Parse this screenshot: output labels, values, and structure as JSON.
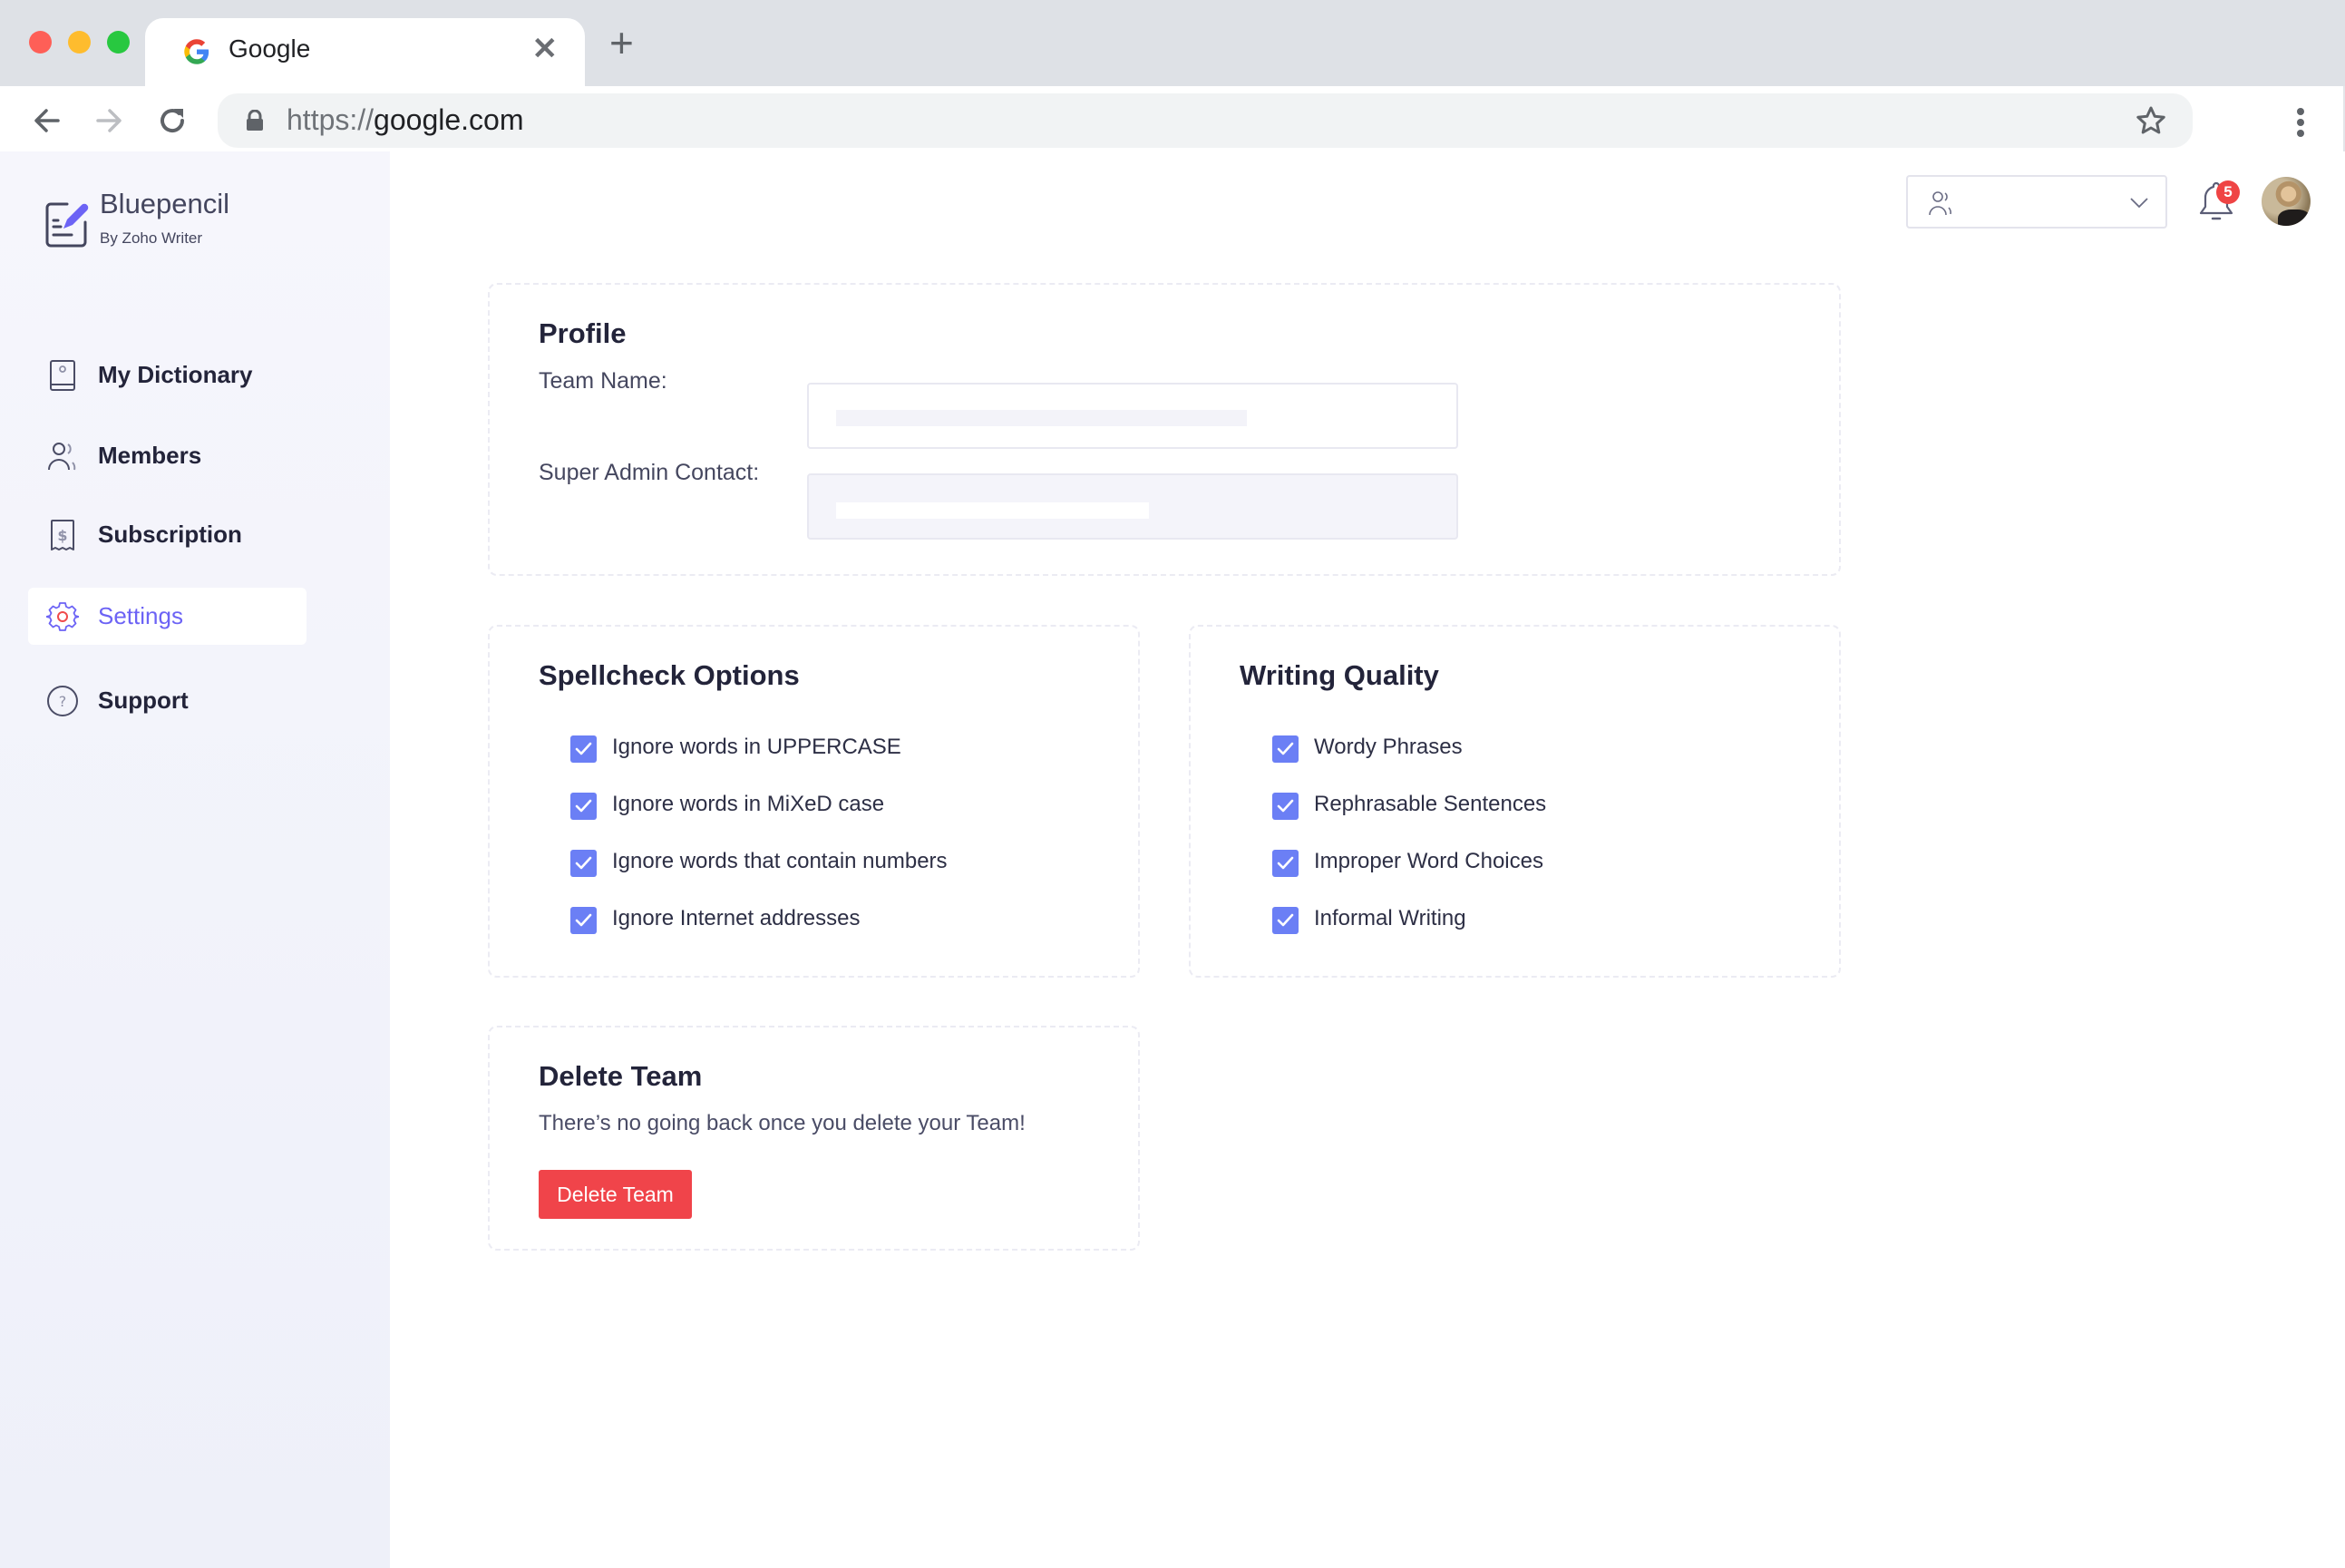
{
  "browser": {
    "tab_title": "Google",
    "tab_favicon": "google-g-icon",
    "url_scheme": "https://",
    "url_host": "google.com",
    "icons": [
      "back-arrow-icon",
      "forward-arrow-icon",
      "reload-icon",
      "lock-icon",
      "star-icon",
      "kebab-menu-icon",
      "close-icon",
      "plus-icon"
    ]
  },
  "app": {
    "brand_name": "Bluepencil",
    "brand_sub": "By Zoho Writer",
    "accent_color": "#6c63f5",
    "checkbox_color": "#6b7ff5",
    "danger_color": "#f0444a"
  },
  "sidebar": {
    "items": [
      {
        "label": "My Dictionary",
        "icon": "dictionary-book-icon",
        "active": false
      },
      {
        "label": "Members",
        "icon": "members-icon",
        "active": false
      },
      {
        "label": "Subscription",
        "icon": "subscription-receipt-icon",
        "active": false
      },
      {
        "label": "Settings",
        "icon": "gear-icon",
        "active": true
      },
      {
        "label": "Support",
        "icon": "help-circle-icon",
        "active": false
      }
    ]
  },
  "header": {
    "team_select_icon": "team-icon",
    "team_select_value": "",
    "notification_count": "5"
  },
  "profile": {
    "title": "Profile",
    "team_name_label": "Team Name:",
    "team_name_value": "",
    "super_admin_label": "Super Admin Contact:",
    "super_admin_value": ""
  },
  "spellcheck": {
    "title": "Spellcheck Options",
    "options": [
      {
        "label": "Ignore words in UPPERCASE",
        "checked": true
      },
      {
        "label": "Ignore words in MiXeD case",
        "checked": true
      },
      {
        "label": "Ignore words that contain numbers",
        "checked": true
      },
      {
        "label": "Ignore Internet addresses",
        "checked": true
      }
    ]
  },
  "writing_quality": {
    "title": "Writing Quality",
    "options": [
      {
        "label": "Wordy Phrases",
        "checked": true
      },
      {
        "label": "Rephrasable Sentences",
        "checked": true
      },
      {
        "label": "Improper Word Choices",
        "checked": true
      },
      {
        "label": "Informal Writing",
        "checked": true
      }
    ]
  },
  "delete_team": {
    "title": "Delete Team",
    "description": "There’s no going back once you delete your Team!",
    "button_label": "Delete Team"
  }
}
